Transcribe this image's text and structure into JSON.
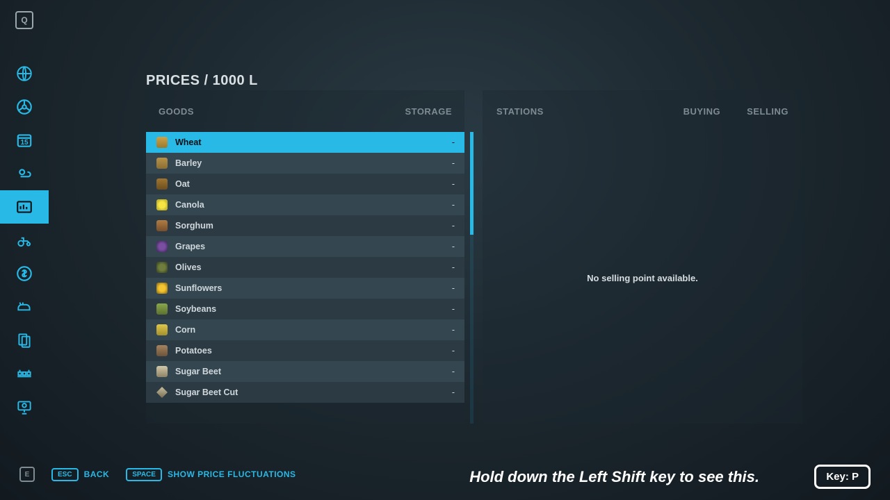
{
  "page_title": "PRICES / 1000 L",
  "top_shortcut": "Q",
  "sidebar_calendar_day": "15",
  "goods_header": {
    "goods": "GOODS",
    "storage": "STORAGE"
  },
  "stations_header": {
    "stations": "STATIONS",
    "buying": "BUYING",
    "selling": "SELLING"
  },
  "stations_empty": "No selling point available.",
  "goods": [
    {
      "name": "Wheat",
      "storage": "-",
      "icon": "ci-wheat",
      "selected": true
    },
    {
      "name": "Barley",
      "storage": "-",
      "icon": "ci-barley"
    },
    {
      "name": "Oat",
      "storage": "-",
      "icon": "ci-oat"
    },
    {
      "name": "Canola",
      "storage": "-",
      "icon": "ci-canola"
    },
    {
      "name": "Sorghum",
      "storage": "-",
      "icon": "ci-sorghum"
    },
    {
      "name": "Grapes",
      "storage": "-",
      "icon": "ci-grapes"
    },
    {
      "name": "Olives",
      "storage": "-",
      "icon": "ci-olives"
    },
    {
      "name": "Sunflowers",
      "storage": "-",
      "icon": "ci-sunflowers"
    },
    {
      "name": "Soybeans",
      "storage": "-",
      "icon": "ci-soybeans"
    },
    {
      "name": "Corn",
      "storage": "-",
      "icon": "ci-corn"
    },
    {
      "name": "Potatoes",
      "storage": "-",
      "icon": "ci-potatoes"
    },
    {
      "name": "Sugar Beet",
      "storage": "-",
      "icon": "ci-sugarbeet"
    },
    {
      "name": "Sugar Beet Cut",
      "storage": "-",
      "icon": "ci-sugarbeetcut"
    }
  ],
  "footer": {
    "left_key": "E",
    "back": {
      "key": "ESC",
      "label": "BACK"
    },
    "fluct": {
      "key": "SPACE",
      "label": "SHOW PRICE FLUCTUATIONS"
    },
    "instruction": "Hold down the Left Shift key to see this.",
    "key_p": "Key: P"
  }
}
